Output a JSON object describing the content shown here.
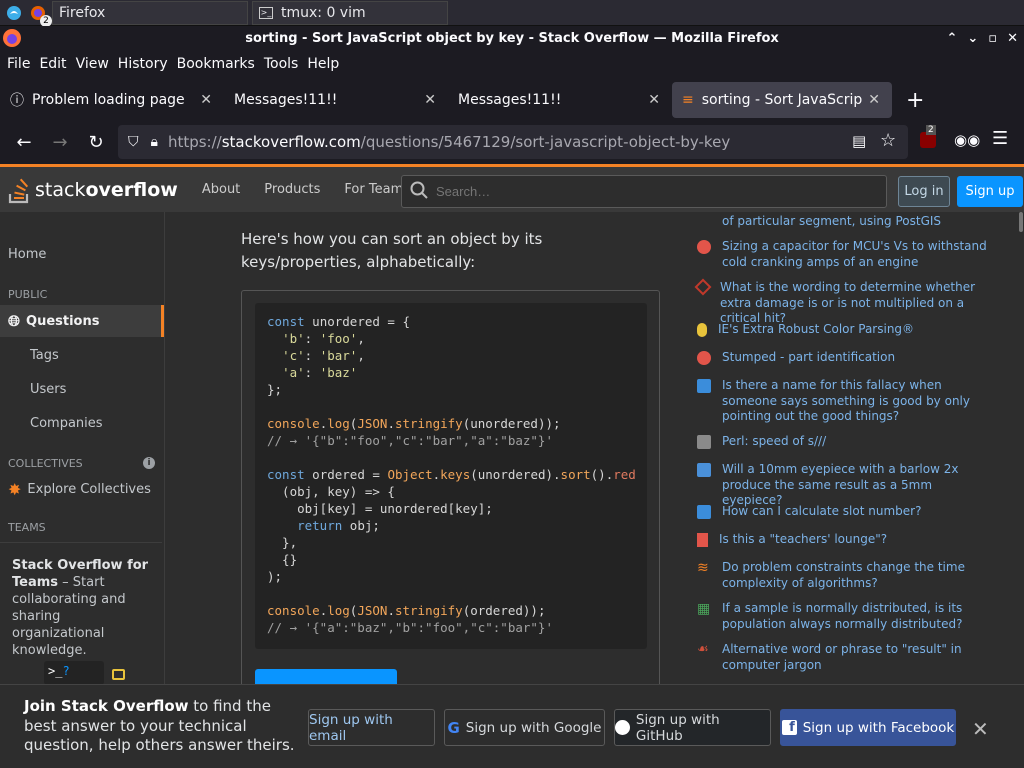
{
  "taskbar": {
    "tasks": [
      {
        "label": "Firefox",
        "badge": "2"
      },
      {
        "label": "tmux: 0 vim"
      }
    ]
  },
  "window": {
    "title": "sorting - Sort JavaScript object by key - Stack Overflow — Mozilla Firefox"
  },
  "menu": [
    "File",
    "Edit",
    "View",
    "History",
    "Bookmarks",
    "Tools",
    "Help"
  ],
  "tabs": [
    {
      "label": "Problem loading page"
    },
    {
      "label": "Messages!11!!"
    },
    {
      "label": "Messages!11!!"
    },
    {
      "label": "sorting - Sort JavaScript o"
    }
  ],
  "url": {
    "scheme": "https://",
    "host": "stackoverflow.com",
    "path": "/questions/5467129/sort-javascript-object-by-key"
  },
  "ext_badge": "2",
  "so": {
    "logo_plain": "stack",
    "logo_bold": "overflow",
    "nav": [
      "About",
      "Products",
      "For Teams"
    ],
    "search_placeholder": "Search…",
    "login": "Log in",
    "signup": "Sign up"
  },
  "leftnav": {
    "home": "Home",
    "public_head": "PUBLIC",
    "questions": "Questions",
    "tags": "Tags",
    "users": "Users",
    "companies": "Companies",
    "collectives_head": "COLLECTIVES",
    "explore": "Explore Collectives",
    "teams_head": "TEAMS",
    "teams_title": "Stack Overflow for Teams",
    "teams_text": " – Start collaborating and sharing organizational knowledge."
  },
  "main": {
    "intro": "Here's how you can sort an object by its keys/properties, alphabetically:"
  },
  "hot_questions": [
    {
      "title": "of particular segment, using PostGIS",
      "icon_color": "#e8a33b"
    },
    {
      "title": "Sizing a capacitor for MCU's Vs to withstand cold cranking amps of an engine",
      "icon_color": "#e2554a"
    },
    {
      "title": "What is the wording to determine whether extra damage is or is not multiplied on a critical hit?",
      "icon_color": "#c0392b"
    },
    {
      "title": "IE's Extra Robust Color Parsing®",
      "icon_color": "#e8c33b"
    },
    {
      "title": "Stumped - part identification",
      "icon_color": "#e2554a"
    },
    {
      "title": "Is there a name for this fallacy when someone says something is good by only pointing out the good things?",
      "icon_color": "#3b8ddb"
    },
    {
      "title": "Perl: speed of s///",
      "icon_color": "#8a8a8a"
    },
    {
      "title": "Will a 10mm eyepiece with a barlow 2x produce the same result as a 5mm eyepiece?",
      "icon_color": "#4a90d9"
    },
    {
      "title": "How can I calculate slot number?",
      "icon_color": "#3b8ddb"
    },
    {
      "title": "Is this a \"teachers' lounge\"?",
      "icon_color": "#e2554a"
    },
    {
      "title": "Do problem constraints change the time complexity of algorithms?",
      "icon_color": "#f48225"
    },
    {
      "title": "If a sample is normally distributed, is its population always normally distributed?",
      "icon_color": "#4aa35a"
    },
    {
      "title": "Alternative word or phrase to \"result\" in computer jargon",
      "icon_color": "#d0503b"
    }
  ],
  "banner": {
    "bold": "Join Stack Overflow",
    "rest": " to find the best answer to your technical question, help others answer theirs.",
    "email": "Sign up with email",
    "google": "Sign up with Google",
    "github": "Sign up with GitHub",
    "facebook": "Sign up with Facebook"
  }
}
